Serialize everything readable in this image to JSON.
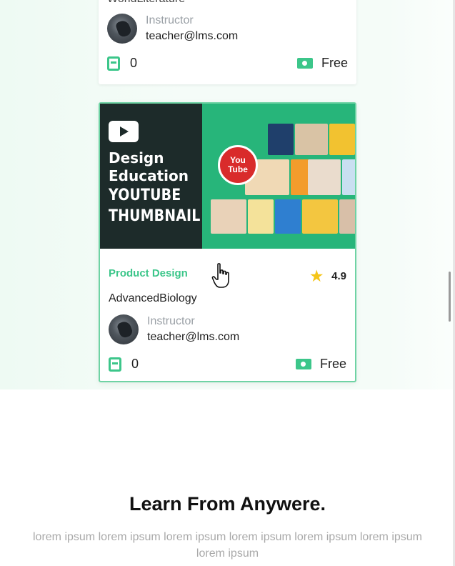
{
  "top_card": {
    "course_name": "WorldLiterature",
    "instructor_label": "Instructor",
    "instructor_email": "teacher@lms.com",
    "lessons_count": "0",
    "price": "Free"
  },
  "main_card": {
    "thumbnail": {
      "line1": "Design",
      "line2": "Education",
      "line3": "YOUTUBE",
      "line4": "THUMBNAIL",
      "badge": "You Tube"
    },
    "category": "Product Design",
    "rating": "4.9",
    "course_name": "AdvancedBiology",
    "instructor_label": "Instructor",
    "instructor_email": "teacher@lms.com",
    "lessons_count": "0",
    "price": "Free"
  },
  "section": {
    "title": "Learn From Anywere.",
    "subtitle": "lorem ipsum lorem ipsum lorem ipsum lorem ipsum lorem ipsum lorem ipsum lorem ipsum"
  },
  "colors": {
    "accent": "#3cc68a",
    "card_border": "#6fd3a4",
    "thumb_dark": "#1d2b2a",
    "thumb_green": "#27b57a",
    "star": "#f5c518"
  }
}
